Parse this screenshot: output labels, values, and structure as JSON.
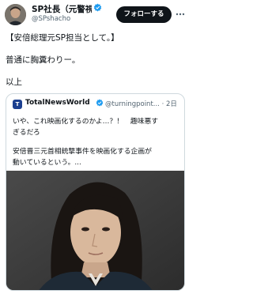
{
  "author": {
    "name": "SP社長（元警視...",
    "handle": "@SPshacho",
    "follow_label": "フォローする"
  },
  "tweet": {
    "lines": [
      "【安倍総理元SP担当として。】",
      "普通に胸糞わりー。",
      "以上"
    ]
  },
  "quoted": {
    "avatar_letter": "T",
    "name": "TotalNewsWorld",
    "handle_time": "@turningpoint... · 2日",
    "lines": [
      "いや、これ映画化するのかよ…？！　趣味悪す",
      "ぎるだろ",
      "安倍晋三元首相銃撃事件を映画化する企画が",
      "動いているという。..."
    ]
  },
  "colors": {
    "accent": "#1d9bf0",
    "text": "#0f1419",
    "muted": "#536471",
    "border": "#cfd9de",
    "button_bg": "#0f1419"
  },
  "icons": {
    "verified": "verified-badge-icon",
    "more": "more-horizontal-icon"
  }
}
